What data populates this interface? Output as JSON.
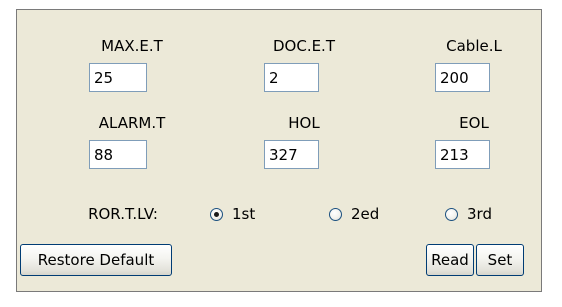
{
  "params": {
    "row1": [
      {
        "label": "MAX.E.T",
        "value": "25"
      },
      {
        "label": "DOC.E.T",
        "value": "2"
      },
      {
        "label": "Cable.L",
        "value": "200"
      }
    ],
    "row2": [
      {
        "label": "ALARM.T",
        "value": "88"
      },
      {
        "label": "HOL",
        "value": "327"
      },
      {
        "label": "EOL",
        "value": "213"
      }
    ]
  },
  "ror": {
    "label": "ROR.T.LV:",
    "options": [
      "1st",
      "2ed",
      "3rd"
    ],
    "selected": "1st"
  },
  "buttons": {
    "restore": "Restore Default",
    "read": "Read",
    "set": "Set"
  }
}
